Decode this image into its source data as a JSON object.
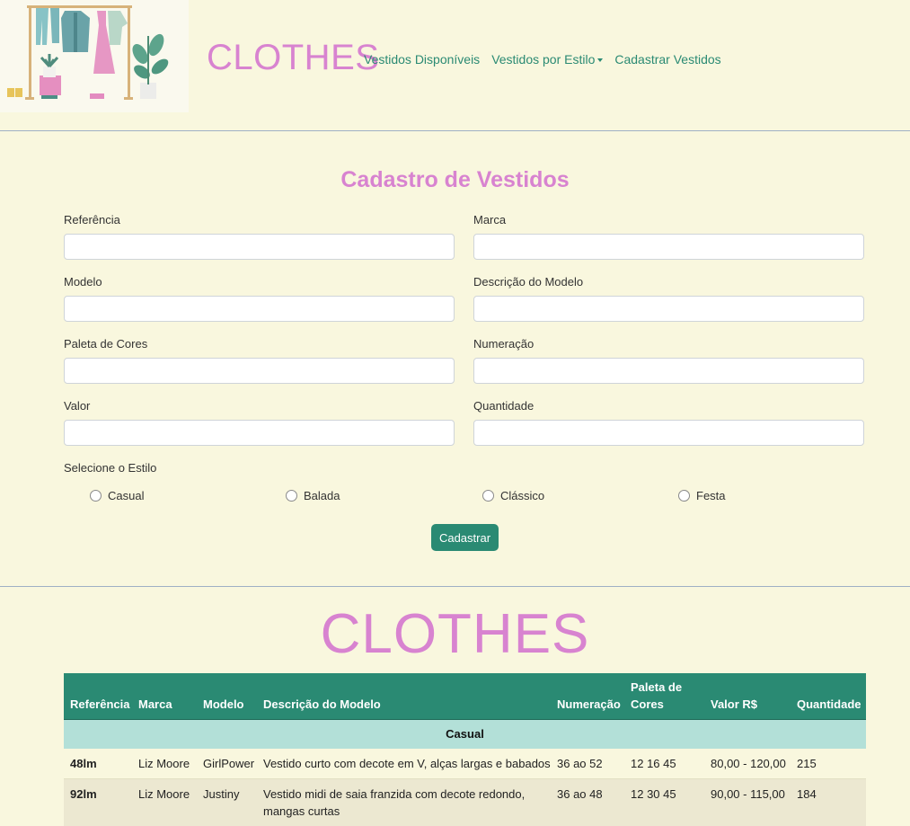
{
  "header": {
    "brand": "CLOTHES",
    "nav": [
      {
        "label": "Vestidos Disponíveis"
      },
      {
        "label": "Vestidos por Estilo"
      },
      {
        "label": "Cadastrar Vestidos"
      }
    ]
  },
  "form": {
    "title": "Cadastro de Vestidos",
    "fields": [
      {
        "label": "Referência",
        "value": ""
      },
      {
        "label": "Marca",
        "value": ""
      },
      {
        "label": "Modelo",
        "value": ""
      },
      {
        "label": "Descrição do Modelo",
        "value": ""
      },
      {
        "label": "Paleta de Cores",
        "value": ""
      },
      {
        "label": "Numeração",
        "value": ""
      },
      {
        "label": "Valor",
        "value": ""
      },
      {
        "label": "Quantidade",
        "value": ""
      }
    ],
    "style_label": "Selecione o Estilo",
    "styles": [
      "Casual",
      "Balada",
      "Clássico",
      "Festa"
    ],
    "submit_label": "Cadastrar"
  },
  "catalog": {
    "brand": "CLOTHES",
    "columns": [
      "Referência",
      "Marca",
      "Modelo",
      "Descrição do Modelo",
      "Numeração",
      "Paleta de Cores",
      "Valor R$",
      "Quantidade"
    ],
    "group": "Casual",
    "rows": [
      {
        "ref": "48lm",
        "marca": "Liz Moore",
        "modelo": "GirlPower",
        "descricao": "Vestido curto com decote em V, alças largas e babados",
        "numeracao": "36 ao 52",
        "paleta": "12 16 45",
        "valor": "80,00 - 120,00",
        "quantidade": "215"
      },
      {
        "ref": "92lm",
        "marca": "Liz Moore",
        "modelo": "Justiny",
        "descricao": "Vestido midi de saia franzida com decote redondo, mangas curtas",
        "numeracao": "36 ao 48",
        "paleta": "12 30 45",
        "valor": "90,00 - 115,00",
        "quantidade": "184"
      }
    ]
  },
  "colors": {
    "accent": "#2a8a73",
    "brand": "#d883d0",
    "background": "#f9f7de"
  }
}
